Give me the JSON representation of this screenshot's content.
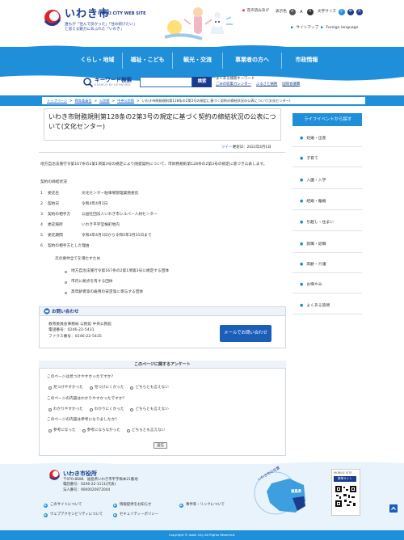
{
  "header": {
    "logo_text": "いわき市",
    "logo_sub": "IWAKI CITY WEB SITE",
    "tagline_line1": "誰もが「住んで良かった」「住み続けたい」",
    "tagline_line2": "と思える魅力にあふれた「いわき」",
    "util": {
      "voice": "音声読みあげ",
      "size_label": "表示色",
      "size_a": "A",
      "size_small": "A",
      "size_large": "A",
      "color_label": "文字サイズ",
      "color_1": "小",
      "color_2": "中",
      "color_3": "大",
      "sitemap": "サイトマップ",
      "foreign": "Foreign language"
    }
  },
  "nav": {
    "items": [
      "くらし・地域",
      "福祉・こども",
      "観光・交流",
      "事業者の方へ",
      "市政情報"
    ]
  },
  "search": {
    "title": "キーワード検索",
    "subtitle": "SEARCH BY KEYWORD",
    "button": "検索",
    "placeholder": "",
    "freq_label": "よくある検索キーワード",
    "links": [
      "ごみの収集カレンダー",
      "ふるさと納税",
      "国保会議費"
    ]
  },
  "breadcrumb": [
    "トップページ",
    "教育委員会",
    "公民館",
    "中央公民館",
    "いわき市財務規則第128条の2第3号の規定に基づく契約の締結状況の公表について(文化センター)"
  ],
  "page": {
    "title": "いわき市財務規則第128条の2第3号の規定に基づく契約の締結状況の公表について(文化センター)",
    "tweet": "ツイート",
    "updated": "更新日：2022年4月1日",
    "intro": "地方自治法施行令第167条の2第1項第3号の規定により随意契約について、市財務規則第128条の2第3号の規定に基づき公表します。",
    "contract_heading": "契約の締結状況",
    "rows": [
      {
        "num": "1",
        "label": "委託名",
        "value": "文化センター駐車場管理業務委託"
      },
      {
        "num": "2",
        "label": "契約日",
        "value": "令和4年4月1日"
      },
      {
        "num": "3",
        "label": "契約の相手方",
        "value": "公益社団法人いわき市シルバー人材センター"
      },
      {
        "num": "4",
        "label": "委託場所",
        "value": "いわき平字堂根町地内"
      },
      {
        "num": "5",
        "label": "委託期間",
        "value": "令和4年4月1日から令和5年3月31日まで"
      },
      {
        "num": "6",
        "label": "契約の相手方とした理由",
        "value": ""
      }
    ],
    "reason_intro": "次の要件全てを満たすため",
    "reasons": [
      "地方自治法施行令第167条の2第1項第3号に規定する団体",
      "市内に拠点を有する団体",
      "高年齢者等の雇用の安定等に寄与する団体"
    ]
  },
  "contact": {
    "title": "お問い合わせ",
    "org": "教育委員会事務局 公民館 中央公民館",
    "tel": "電話番号：0246-22-5431",
    "fax": "ファクス番号：0246-22-5435",
    "mail_button": "メールでお問い合わせ"
  },
  "survey": {
    "title": "このページに関するアンケート",
    "q1": "このページは見つけやすかったですか？",
    "q1_opts": [
      "見つけやすかった",
      "見つけにくかった",
      "どちらとも言えない"
    ],
    "q2": "このページの内容はわかりやすかったですか？",
    "q2_opts": [
      "わかりやすかった",
      "わかりにくかった",
      "どちらとも言えない"
    ],
    "q3": "このページの内容は参考になりましたか？",
    "q3_opts": [
      "参考になった",
      "参考にならなかった",
      "どちらとも言えない"
    ],
    "submit": "送信"
  },
  "sidebar": {
    "title": "ライフイベントから探す",
    "items": [
      "妊娠・出産",
      "子育て",
      "入園・入学",
      "結婚・離婚",
      "引越し・住まい",
      "就職・退職",
      "高齢・介護",
      "お悔やみ",
      "よくある質問"
    ]
  },
  "footer": {
    "name": "いわき市役所",
    "addr1": "〒970-8686　福島県いわき市平字梅本21番地",
    "addr2": "電話番号：0246-22-1111(代表)",
    "addr3": "法人番号：9000020072044",
    "links": [
      "このサイトについて",
      "情報提供をお知らせ",
      "事件等・リンクについて",
      "ウェブアクセシビリティについて",
      "セキュリティーポリシー"
    ],
    "map_label": "いわき市の位置",
    "map_pref": "福島県",
    "mobile_label": "MOBILE SITE",
    "mobile_btn": "携帯サイト",
    "copyright": "Copyright © Iwaki City All Rights Reserved."
  }
}
